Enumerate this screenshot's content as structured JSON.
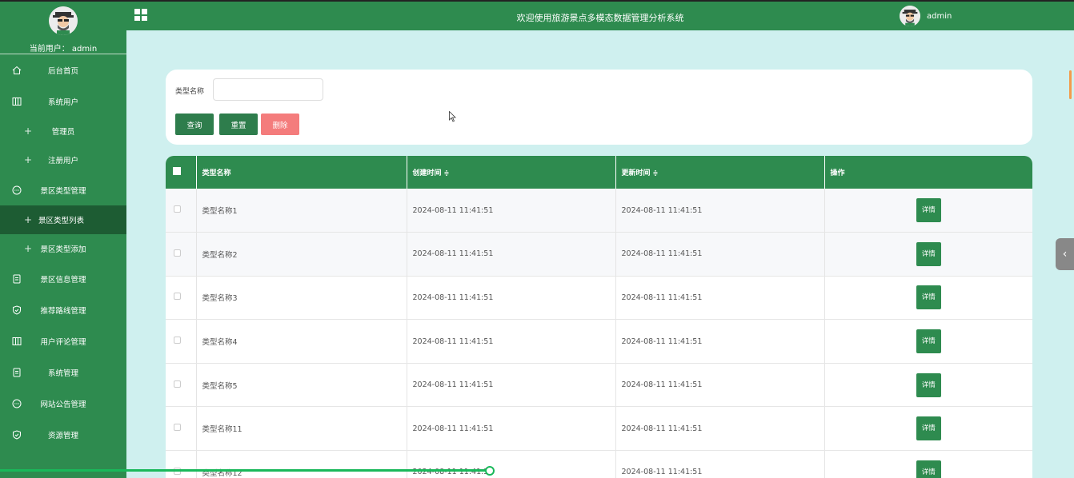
{
  "app": {
    "title": "欢迎使用旅游景点多模态数据管理分析系统",
    "user_name": "admin"
  },
  "sidebar": {
    "current_user": "当前用户： admin",
    "items": [
      {
        "label": "后台首页",
        "icon": "home-icon"
      },
      {
        "label": "系统用户",
        "icon": "columns-icon"
      },
      {
        "label": "管理员",
        "sub": true
      },
      {
        "label": "注册用户",
        "sub": true
      },
      {
        "label": "景区类型管理",
        "icon": "chat-icon"
      },
      {
        "label": "景区类型列表",
        "sub": true,
        "active": true
      },
      {
        "label": "景区类型添加",
        "sub": true
      },
      {
        "label": "景区信息管理",
        "icon": "document-icon"
      },
      {
        "label": "推荐路线管理",
        "icon": "shield-icon"
      },
      {
        "label": "用户评论管理",
        "icon": "columns-icon"
      },
      {
        "label": "系统管理",
        "icon": "document-icon"
      },
      {
        "label": "网站公告管理",
        "icon": "chat-icon"
      },
      {
        "label": "资源管理",
        "icon": "shield-icon"
      }
    ]
  },
  "search": {
    "label": "类型名称",
    "value": "",
    "placeholder": "",
    "query_label": "查询",
    "reset_label": "重置",
    "delete_label": "删除"
  },
  "table": {
    "columns": [
      "类型名称",
      "创建时间",
      "更新时间",
      "操作"
    ],
    "sort_mark": "≑",
    "detail_label": "详情",
    "rows": [
      {
        "name": "类型名称1",
        "created": "2024-08-11 11:41:51",
        "updated": "2024-08-11 11:41:51"
      },
      {
        "name": "类型名称2",
        "created": "2024-08-11 11:41:51",
        "updated": "2024-08-11 11:41:51"
      },
      {
        "name": "类型名称3",
        "created": "2024-08-11 11:41:51",
        "updated": "2024-08-11 11:41:51"
      },
      {
        "name": "类型名称4",
        "created": "2024-08-11 11:41:51",
        "updated": "2024-08-11 11:41:51"
      },
      {
        "name": "类型名称5",
        "created": "2024-08-11 11:41:51",
        "updated": "2024-08-11 11:41:51"
      },
      {
        "name": "类型名称11",
        "created": "2024-08-11 11:41:51",
        "updated": "2024-08-11 11:41:51"
      },
      {
        "name": "类型名称12",
        "created": "2024-08-11 11:41:51",
        "updated": "2024-08-11 11:41:51"
      }
    ]
  },
  "colors": {
    "primary": "#2e8b4f",
    "active_nav": "#1d5c33",
    "background": "#cff0ef",
    "delete": "#f47c7c"
  }
}
